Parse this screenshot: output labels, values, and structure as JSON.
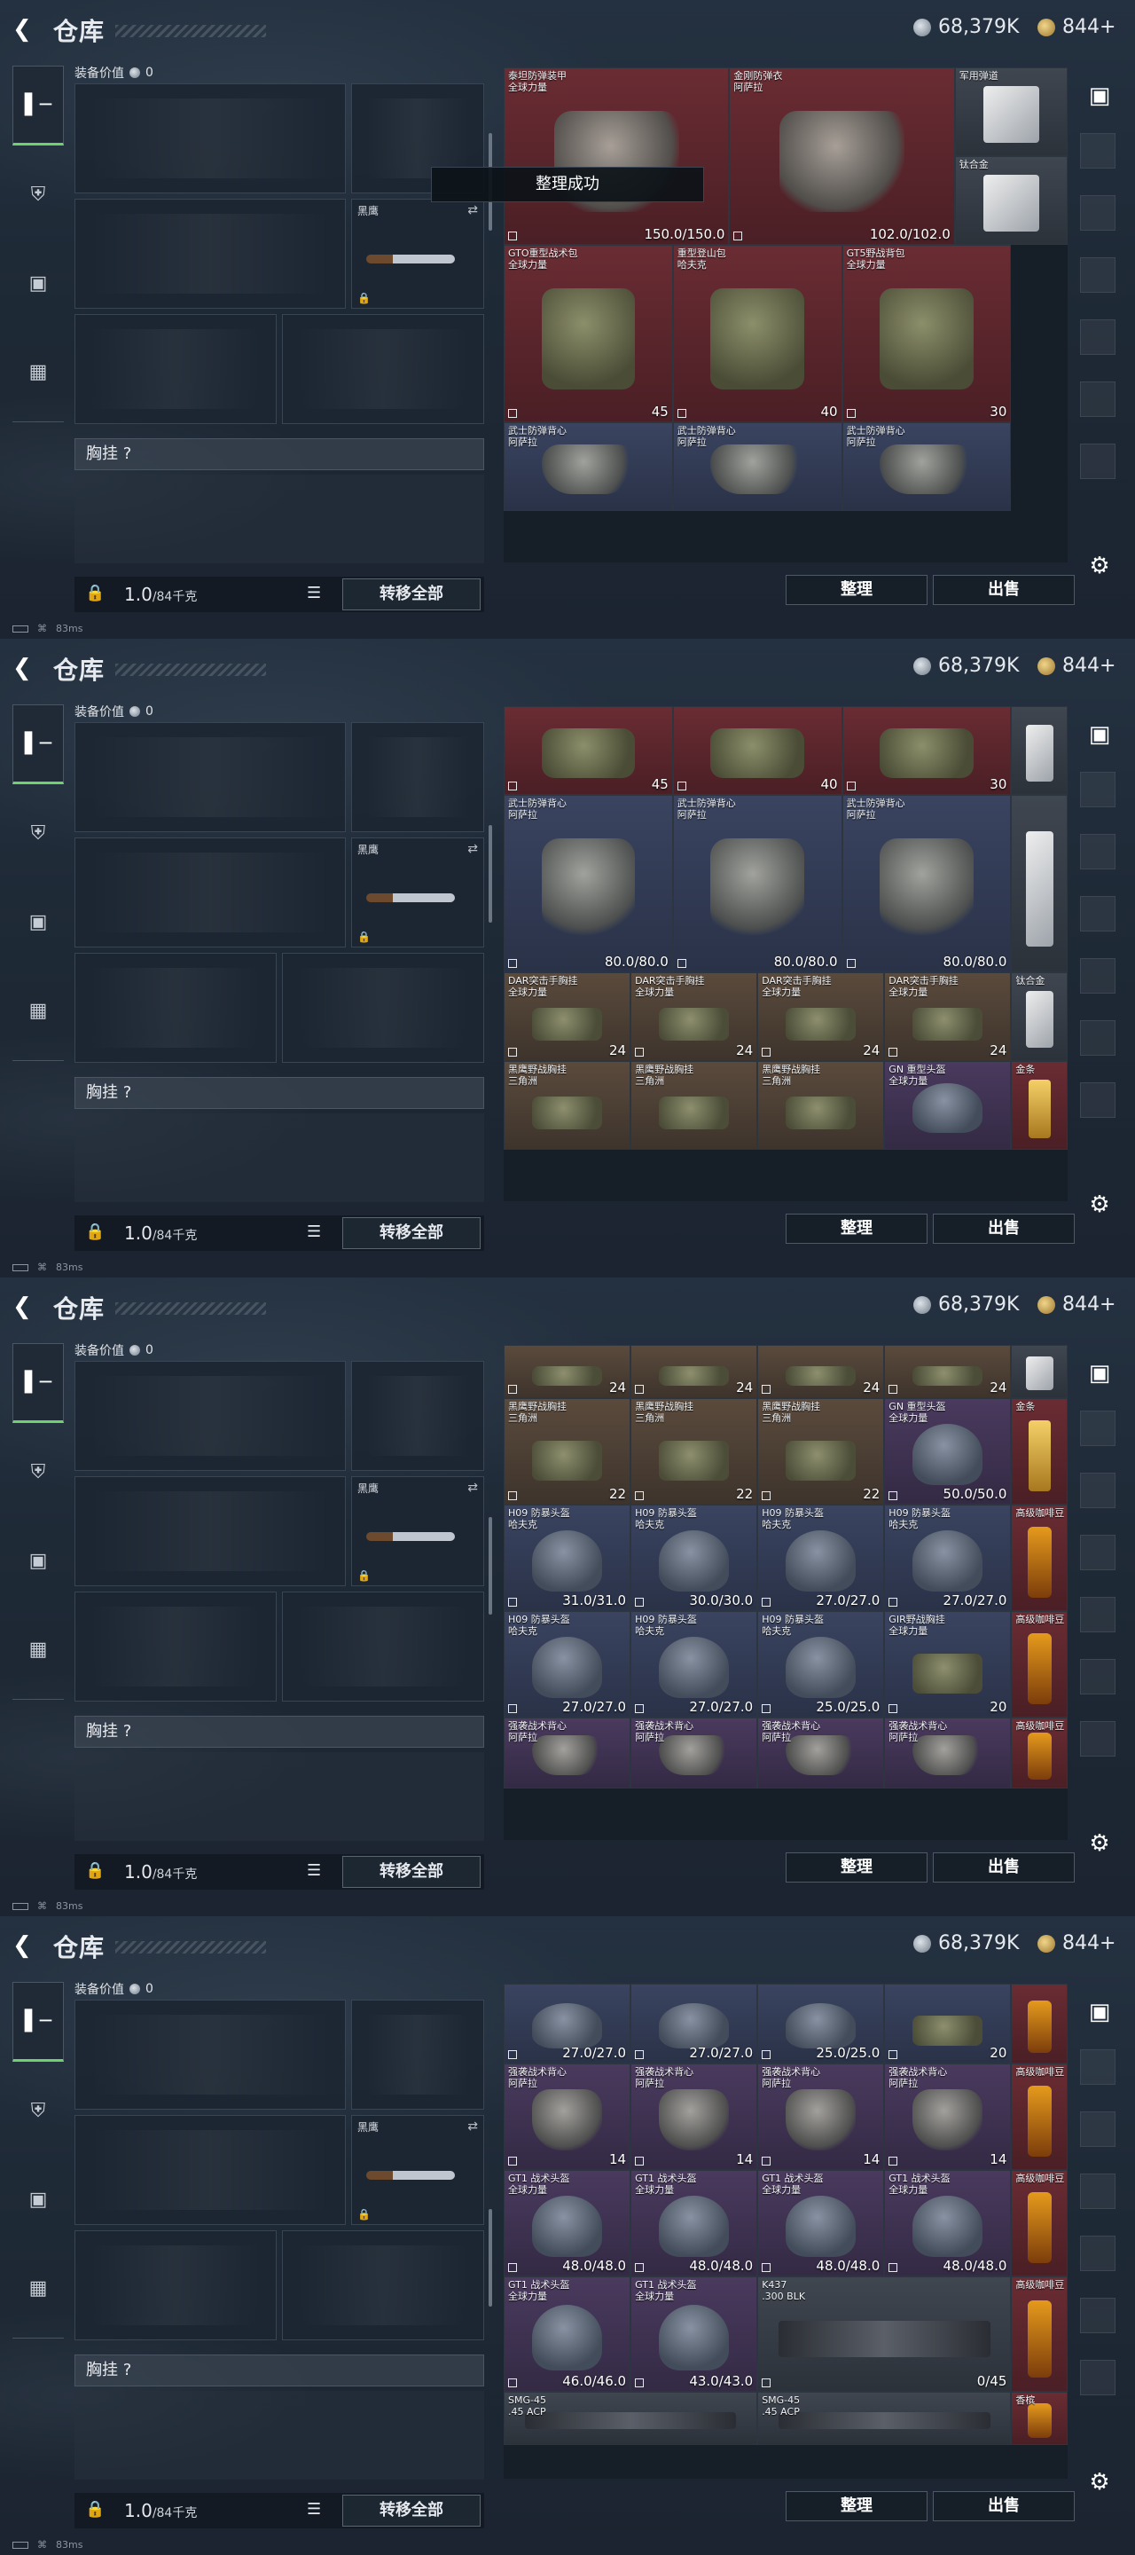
{
  "header": {
    "title": "仓库",
    "back_icon": "back-arrow-icon",
    "currency_1": "68,379K",
    "currency_2": "844+"
  },
  "loadout": {
    "equip_value_label": "装备价值",
    "equip_value": "0",
    "knife_name": "黑鹰",
    "chest_label": "胸挂 ?",
    "weight": "1.0",
    "weight_cap": "/84千克",
    "transfer_all": "转移全部"
  },
  "buttons": {
    "sort": "整理",
    "sell": "出售"
  },
  "toast": "整理成功",
  "status": {
    "ping": "83ms",
    "signal": "0"
  },
  "tabs": [
    {
      "icon": "pistol-icon",
      "active": true
    },
    {
      "icon": "armor-icon",
      "active": false
    },
    {
      "icon": "backpack-icon",
      "active": false
    },
    {
      "icon": "briefcase-icon",
      "active": false
    }
  ],
  "side_icons": [
    "backpack-side-icon",
    "settings-gear-icon"
  ],
  "screens": [
    {
      "items": [
        {
          "row": 0,
          "col": 0,
          "w": 2,
          "h": 2,
          "name": "泰坦防弹装甲\n全球力量",
          "dur": "150.0/150.0",
          "color": "red",
          "art": "armor"
        },
        {
          "row": 0,
          "col": 2,
          "w": 2,
          "h": 2,
          "name": "金刚防弹衣\n阿萨拉",
          "dur": "102.0/102.0",
          "color": "red",
          "art": "armor"
        },
        {
          "row": 0,
          "col": 4,
          "w": 1,
          "h": 1,
          "name": "军用弹道",
          "dur": "",
          "color": "gray",
          "art": "plate"
        },
        {
          "row": 1,
          "col": 4,
          "w": 1,
          "h": 1,
          "name": "钛合金",
          "dur": "",
          "color": "gray",
          "art": "plate"
        },
        {
          "row": 2,
          "col": 0,
          "w": 1.5,
          "h": 2,
          "name": "GTO重型战术包\n全球力量",
          "dur": "45",
          "color": "red",
          "art": "pack"
        },
        {
          "row": 2,
          "col": 1.5,
          "w": 1.5,
          "h": 2,
          "name": "重型登山包\n哈夫克",
          "dur": "40",
          "color": "red",
          "art": "pack"
        },
        {
          "row": 2,
          "col": 3,
          "w": 1.5,
          "h": 2,
          "name": "GT5野战背包\n全球力量",
          "dur": "30",
          "color": "red",
          "art": "pack"
        },
        {
          "row": 4,
          "col": 0,
          "w": 1.5,
          "h": 1,
          "name": "武士防弹背心\n阿萨拉",
          "dur": "",
          "color": "blue",
          "art": "armor"
        },
        {
          "row": 4,
          "col": 1.5,
          "w": 1.5,
          "h": 1,
          "name": "武士防弹背心\n阿萨拉",
          "dur": "",
          "color": "blue",
          "art": "armor"
        },
        {
          "row": 4,
          "col": 3,
          "w": 1.5,
          "h": 1,
          "name": "武士防弹背心\n阿萨拉",
          "dur": "",
          "color": "blue",
          "art": "armor"
        }
      ]
    },
    {
      "items": [
        {
          "row": 0,
          "col": 0,
          "w": 1.5,
          "h": 1,
          "name": "",
          "dur": "45",
          "color": "red",
          "art": "pack"
        },
        {
          "row": 0,
          "col": 1.5,
          "w": 1.5,
          "h": 1,
          "name": "",
          "dur": "40",
          "color": "red",
          "art": "pack"
        },
        {
          "row": 0,
          "col": 3,
          "w": 1.5,
          "h": 1,
          "name": "",
          "dur": "30",
          "color": "red",
          "art": "pack"
        },
        {
          "row": 1,
          "col": 0,
          "w": 1.5,
          "h": 2,
          "name": "武士防弹背心\n阿萨拉",
          "dur": "80.0/80.0",
          "color": "blue",
          "art": "armor"
        },
        {
          "row": 1,
          "col": 1.5,
          "w": 1.5,
          "h": 2,
          "name": "武士防弹背心\n阿萨拉",
          "dur": "80.0/80.0",
          "color": "blue",
          "art": "armor"
        },
        {
          "row": 1,
          "col": 3,
          "w": 1.5,
          "h": 2,
          "name": "武士防弹背心\n阿萨拉",
          "dur": "80.0/80.0",
          "color": "blue",
          "art": "armor"
        },
        {
          "row": 0,
          "col": 4.5,
          "w": 0.5,
          "h": 1,
          "name": "",
          "dur": "",
          "color": "gray",
          "art": "plate"
        },
        {
          "row": 1,
          "col": 4.5,
          "w": 0.5,
          "h": 2,
          "name": "",
          "dur": "",
          "color": "gray",
          "art": "plate"
        },
        {
          "row": 3,
          "col": 0,
          "w": 1.125,
          "h": 1,
          "name": "DAR突击手胸挂\n全球力量",
          "dur": "24",
          "color": "brown",
          "art": "rig"
        },
        {
          "row": 3,
          "col": 1.125,
          "w": 1.125,
          "h": 1,
          "name": "DAR突击手胸挂\n全球力量",
          "dur": "24",
          "color": "brown",
          "art": "rig"
        },
        {
          "row": 3,
          "col": 2.25,
          "w": 1.125,
          "h": 1,
          "name": "DAR突击手胸挂\n全球力量",
          "dur": "24",
          "color": "brown",
          "art": "rig"
        },
        {
          "row": 3,
          "col": 3.375,
          "w": 1.125,
          "h": 1,
          "name": "DAR突击手胸挂\n全球力量",
          "dur": "24",
          "color": "brown",
          "art": "rig"
        },
        {
          "row": 3,
          "col": 4.5,
          "w": 0.5,
          "h": 1,
          "name": "钛合金",
          "dur": "",
          "color": "gray",
          "art": "plate"
        },
        {
          "row": 4,
          "col": 0,
          "w": 1.125,
          "h": 1,
          "name": "黑鹰野战胸挂\n三角洲",
          "dur": "",
          "color": "brown",
          "art": "rig"
        },
        {
          "row": 4,
          "col": 1.125,
          "w": 1.125,
          "h": 1,
          "name": "黑鹰野战胸挂\n三角洲",
          "dur": "",
          "color": "brown",
          "art": "rig"
        },
        {
          "row": 4,
          "col": 2.25,
          "w": 1.125,
          "h": 1,
          "name": "黑鹰野战胸挂\n三角洲",
          "dur": "",
          "color": "brown",
          "art": "rig"
        },
        {
          "row": 4,
          "col": 3.375,
          "w": 1.125,
          "h": 1,
          "name": "GN 重型头盔\n全球力量",
          "dur": "",
          "color": "purple",
          "art": "helm"
        },
        {
          "row": 4,
          "col": 4.5,
          "w": 0.5,
          "h": 1,
          "name": "金条",
          "dur": "",
          "color": "red",
          "art": "gold"
        }
      ]
    },
    {
      "items": [
        {
          "row": 0,
          "col": 0,
          "w": 1.125,
          "h": 0.6,
          "name": "",
          "dur": "24",
          "color": "brown",
          "art": "rig"
        },
        {
          "row": 0,
          "col": 1.125,
          "w": 1.125,
          "h": 0.6,
          "name": "",
          "dur": "24",
          "color": "brown",
          "art": "rig"
        },
        {
          "row": 0,
          "col": 2.25,
          "w": 1.125,
          "h": 0.6,
          "name": "",
          "dur": "24",
          "color": "brown",
          "art": "rig"
        },
        {
          "row": 0,
          "col": 3.375,
          "w": 1.125,
          "h": 0.6,
          "name": "",
          "dur": "24",
          "color": "brown",
          "art": "rig"
        },
        {
          "row": 0,
          "col": 4.5,
          "w": 0.5,
          "h": 0.6,
          "name": "",
          "dur": "",
          "color": "gray",
          "art": "plate"
        },
        {
          "row": 0.6,
          "col": 0,
          "w": 1.125,
          "h": 1.2,
          "name": "黑鹰野战胸挂\n三角洲",
          "dur": "22",
          "color": "brown",
          "art": "rig"
        },
        {
          "row": 0.6,
          "col": 1.125,
          "w": 1.125,
          "h": 1.2,
          "name": "黑鹰野战胸挂\n三角洲",
          "dur": "22",
          "color": "brown",
          "art": "rig"
        },
        {
          "row": 0.6,
          "col": 2.25,
          "w": 1.125,
          "h": 1.2,
          "name": "黑鹰野战胸挂\n三角洲",
          "dur": "22",
          "color": "brown",
          "art": "rig"
        },
        {
          "row": 0.6,
          "col": 3.375,
          "w": 1.125,
          "h": 1.2,
          "name": "GN 重型头盔\n全球力量",
          "dur": "50.0/50.0",
          "color": "purple",
          "art": "helm"
        },
        {
          "row": 0.6,
          "col": 4.5,
          "w": 0.5,
          "h": 1.2,
          "name": "金条",
          "dur": "",
          "color": "red",
          "art": "gold"
        },
        {
          "row": 1.8,
          "col": 0,
          "w": 1.125,
          "h": 1.2,
          "name": "H09 防暴头盔\n哈夫克",
          "dur": "31.0/31.0",
          "color": "blue",
          "art": "helm"
        },
        {
          "row": 1.8,
          "col": 1.125,
          "w": 1.125,
          "h": 1.2,
          "name": "H09 防暴头盔\n哈夫克",
          "dur": "30.0/30.0",
          "color": "blue",
          "art": "helm"
        },
        {
          "row": 1.8,
          "col": 2.25,
          "w": 1.125,
          "h": 1.2,
          "name": "H09 防暴头盔\n哈夫克",
          "dur": "27.0/27.0",
          "color": "blue",
          "art": "helm"
        },
        {
          "row": 1.8,
          "col": 3.375,
          "w": 1.125,
          "h": 1.2,
          "name": "H09 防暴头盔\n哈夫克",
          "dur": "27.0/27.0",
          "color": "blue",
          "art": "helm"
        },
        {
          "row": 1.8,
          "col": 4.5,
          "w": 0.5,
          "h": 1.2,
          "name": "高级咖啡豆",
          "dur": "",
          "color": "red",
          "art": "coffee"
        },
        {
          "row": 3.0,
          "col": 0,
          "w": 1.125,
          "h": 1.2,
          "name": "H09 防暴头盔\n哈夫克",
          "dur": "27.0/27.0",
          "color": "blue",
          "art": "helm"
        },
        {
          "row": 3.0,
          "col": 1.125,
          "w": 1.125,
          "h": 1.2,
          "name": "H09 防暴头盔\n哈夫克",
          "dur": "27.0/27.0",
          "color": "blue",
          "art": "helm"
        },
        {
          "row": 3.0,
          "col": 2.25,
          "w": 1.125,
          "h": 1.2,
          "name": "H09 防暴头盔\n哈夫克",
          "dur": "25.0/25.0",
          "color": "blue",
          "art": "helm"
        },
        {
          "row": 3.0,
          "col": 3.375,
          "w": 1.125,
          "h": 1.2,
          "name": "GIR野战胸挂\n全球力量",
          "dur": "20",
          "color": "blue",
          "art": "rig"
        },
        {
          "row": 3.0,
          "col": 4.5,
          "w": 0.5,
          "h": 1.2,
          "name": "高级咖啡豆",
          "dur": "",
          "color": "red",
          "art": "coffee"
        },
        {
          "row": 4.2,
          "col": 0,
          "w": 1.125,
          "h": 0.8,
          "name": "强袭战术背心\n阿萨拉",
          "dur": "",
          "color": "purple",
          "art": "armor"
        },
        {
          "row": 4.2,
          "col": 1.125,
          "w": 1.125,
          "h": 0.8,
          "name": "强袭战术背心\n阿萨拉",
          "dur": "",
          "color": "purple",
          "art": "armor"
        },
        {
          "row": 4.2,
          "col": 2.25,
          "w": 1.125,
          "h": 0.8,
          "name": "强袭战术背心\n阿萨拉",
          "dur": "",
          "color": "purple",
          "art": "armor"
        },
        {
          "row": 4.2,
          "col": 3.375,
          "w": 1.125,
          "h": 0.8,
          "name": "强袭战术背心\n阿萨拉",
          "dur": "",
          "color": "purple",
          "art": "armor"
        },
        {
          "row": 4.2,
          "col": 4.5,
          "w": 0.5,
          "h": 0.8,
          "name": "高级咖啡豆",
          "dur": "",
          "color": "red",
          "art": "coffee"
        }
      ]
    },
    {
      "items": [
        {
          "row": 0,
          "col": 0,
          "w": 1.125,
          "h": 0.9,
          "name": "",
          "dur": "27.0/27.0",
          "color": "blue",
          "art": "helm"
        },
        {
          "row": 0,
          "col": 1.125,
          "w": 1.125,
          "h": 0.9,
          "name": "",
          "dur": "27.0/27.0",
          "color": "blue",
          "art": "helm"
        },
        {
          "row": 0,
          "col": 2.25,
          "w": 1.125,
          "h": 0.9,
          "name": "",
          "dur": "25.0/25.0",
          "color": "blue",
          "art": "helm"
        },
        {
          "row": 0,
          "col": 3.375,
          "w": 1.125,
          "h": 0.9,
          "name": "",
          "dur": "20",
          "color": "blue",
          "art": "rig"
        },
        {
          "row": 0,
          "col": 4.5,
          "w": 0.5,
          "h": 0.9,
          "name": "",
          "dur": "",
          "color": "red",
          "art": "coffee"
        },
        {
          "row": 0.9,
          "col": 0,
          "w": 1.125,
          "h": 1.2,
          "name": "强袭战术背心\n阿萨拉",
          "dur": "14",
          "color": "purple",
          "art": "armor"
        },
        {
          "row": 0.9,
          "col": 1.125,
          "w": 1.125,
          "h": 1.2,
          "name": "强袭战术背心\n阿萨拉",
          "dur": "14",
          "color": "purple",
          "art": "armor"
        },
        {
          "row": 0.9,
          "col": 2.25,
          "w": 1.125,
          "h": 1.2,
          "name": "强袭战术背心\n阿萨拉",
          "dur": "14",
          "color": "purple",
          "art": "armor"
        },
        {
          "row": 0.9,
          "col": 3.375,
          "w": 1.125,
          "h": 1.2,
          "name": "强袭战术背心\n阿萨拉",
          "dur": "14",
          "color": "purple",
          "art": "armor"
        },
        {
          "row": 0.9,
          "col": 4.5,
          "w": 0.5,
          "h": 1.2,
          "name": "高级咖啡豆",
          "dur": "",
          "color": "red",
          "art": "coffee"
        },
        {
          "row": 2.1,
          "col": 0,
          "w": 1.125,
          "h": 1.2,
          "name": "GT1 战术头盔\n全球力量",
          "dur": "48.0/48.0",
          "color": "purple",
          "art": "helm"
        },
        {
          "row": 2.1,
          "col": 1.125,
          "w": 1.125,
          "h": 1.2,
          "name": "GT1 战术头盔\n全球力量",
          "dur": "48.0/48.0",
          "color": "purple",
          "art": "helm"
        },
        {
          "row": 2.1,
          "col": 2.25,
          "w": 1.125,
          "h": 1.2,
          "name": "GT1 战术头盔\n全球力量",
          "dur": "48.0/48.0",
          "color": "purple",
          "art": "helm"
        },
        {
          "row": 2.1,
          "col": 3.375,
          "w": 1.125,
          "h": 1.2,
          "name": "GT1 战术头盔\n全球力量",
          "dur": "48.0/48.0",
          "color": "purple",
          "art": "helm"
        },
        {
          "row": 2.1,
          "col": 4.5,
          "w": 0.5,
          "h": 1.2,
          "name": "高级咖啡豆",
          "dur": "",
          "color": "red",
          "art": "coffee"
        },
        {
          "row": 3.3,
          "col": 0,
          "w": 1.125,
          "h": 1.3,
          "name": "GT1 战术头盔\n全球力量",
          "dur": "46.0/46.0",
          "color": "purple",
          "art": "helm"
        },
        {
          "row": 3.3,
          "col": 1.125,
          "w": 1.125,
          "h": 1.3,
          "name": "GT1 战术头盔\n全球力量",
          "dur": "43.0/43.0",
          "color": "purple",
          "art": "helm"
        },
        {
          "row": 3.3,
          "col": 2.25,
          "w": 2.25,
          "h": 1.3,
          "name": "K437\n.300 BLK",
          "dur": "0/45",
          "color": "gray",
          "art": "gun"
        },
        {
          "row": 3.3,
          "col": 4.5,
          "w": 0.5,
          "h": 1.3,
          "name": "高级咖啡豆",
          "dur": "",
          "color": "red",
          "art": "coffee"
        },
        {
          "row": 4.6,
          "col": 0,
          "w": 2.25,
          "h": 0.6,
          "name": "SMG-45\n.45 ACP",
          "dur": "",
          "color": "gray",
          "art": "gun"
        },
        {
          "row": 4.6,
          "col": 2.25,
          "w": 2.25,
          "h": 0.6,
          "name": "SMG-45\n.45 ACP",
          "dur": "",
          "color": "gray",
          "art": "gun"
        },
        {
          "row": 4.6,
          "col": 4.5,
          "w": 0.5,
          "h": 0.6,
          "name": "香槟",
          "dur": "",
          "color": "red",
          "art": "coffee"
        }
      ]
    }
  ]
}
